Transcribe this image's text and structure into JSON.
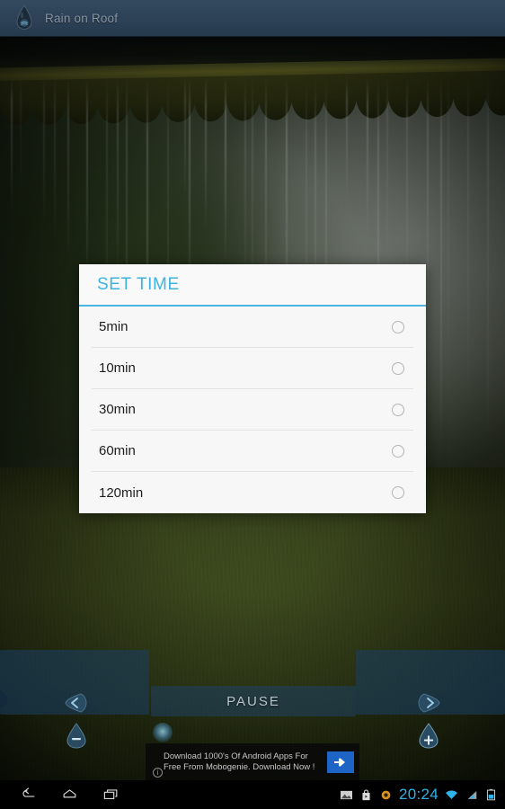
{
  "app": {
    "title": "Rain on Roof",
    "logo_icon": "water-drop-icon"
  },
  "dialog": {
    "title": "SET TIME",
    "accent_color": "#3eb3e0",
    "background_color": "#f7f7f7",
    "options": [
      {
        "label": "5min",
        "selected": false
      },
      {
        "label": "10min",
        "selected": false
      },
      {
        "label": "30min",
        "selected": false
      },
      {
        "label": "60min",
        "selected": false
      },
      {
        "label": "120min",
        "selected": false
      }
    ]
  },
  "controls": {
    "pause_label": "PAUSE",
    "left_panel": {
      "prev_icon": "drop-left-arrow-icon",
      "volume_down_icon": "drop-minus-icon"
    },
    "right_panel": {
      "next_icon": "drop-right-arrow-icon",
      "volume_up_icon": "drop-plus-icon"
    },
    "center_icon": "glow-orb-icon"
  },
  "ad": {
    "text": "Download 1000's Of Android Apps For Free From Mobogenie. Download Now !",
    "info_icon": "info-icon",
    "cta_icon": "arrow-right-icon",
    "cta_color": "#1d64c4"
  },
  "navbar": {
    "back_icon": "back-arrow-icon",
    "home_icon": "home-icon",
    "recents_icon": "recent-apps-icon"
  },
  "statusbar": {
    "screenshot_icon": "image-icon",
    "store_icon": "play-store-bag-icon",
    "update_icon": "orange-circle-icon",
    "time": "20:24",
    "wifi_icon": "wifi-icon",
    "signal_icon": "cell-signal-icon",
    "battery_icon": "battery-icon",
    "clock_color": "#2fb2e8"
  },
  "scene": {
    "description_icon": "rain-on-roof-photo"
  }
}
